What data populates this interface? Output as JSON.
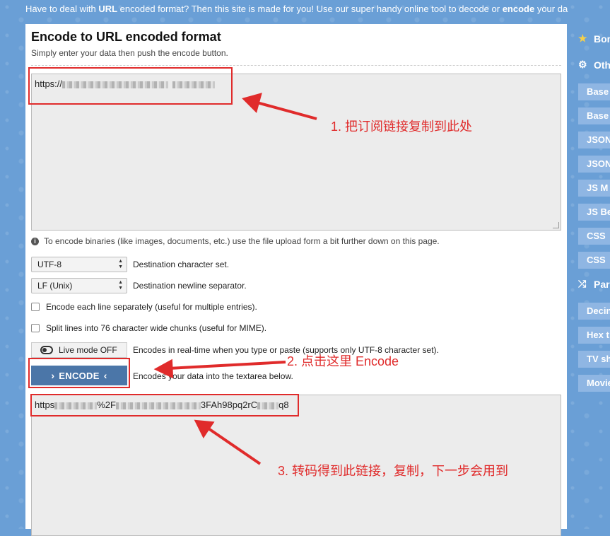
{
  "banner": {
    "prefix": "Have to deal with ",
    "url_bold": "URL",
    "middle": " encoded format? Then this site is made for you! Use our super handy online tool to decode or ",
    "encode_bold": "encode",
    "suffix": " your da"
  },
  "main": {
    "title": "Encode to URL encoded format",
    "subtitle": "Simply enter your data then push the encode button.",
    "input_value": "https://",
    "info_text": "To encode binaries (like images, documents, etc.) use the file upload form a bit further down on this page.",
    "charset": {
      "value": "UTF-8",
      "label": "Destination character set."
    },
    "newline": {
      "value": "LF (Unix)",
      "label": "Destination newline separator."
    },
    "checkbox_each_line": "Encode each line separately (useful for multiple entries).",
    "checkbox_split": "Split lines into 76 character wide chunks (useful for MIME).",
    "live_mode": {
      "label": "Live mode OFF",
      "description": "Encodes in real-time when you type or paste (supports only UTF-8 character set)."
    },
    "encode_button": {
      "label": "ENCODE",
      "description": "Encodes your data into the textarea below."
    },
    "output_prefix": "https",
    "output_mid": "%2F",
    "output_mid2": "3FAh98pq2rC",
    "output_suffix": "q8"
  },
  "sidebar": {
    "bookmark": "Bon",
    "other": "Oth",
    "items": [
      "Base",
      "Base",
      "JSON",
      "JSON",
      "JS M",
      "JS Be",
      "CSS",
      "CSS"
    ],
    "parsers": "Par",
    "items2": [
      "Decin",
      "Hex t",
      "TV sh",
      "Movie"
    ]
  },
  "annotations": {
    "step1": "1. 把订阅链接复制到此处",
    "step2": "2. 点击这里 Encode",
    "step3": "3. 转码得到此链接，复制，下一步会用到"
  },
  "colors": {
    "annotation_red": "#e02b2b",
    "button_blue": "#4b76a8",
    "page_blue": "#6a9fd6"
  }
}
